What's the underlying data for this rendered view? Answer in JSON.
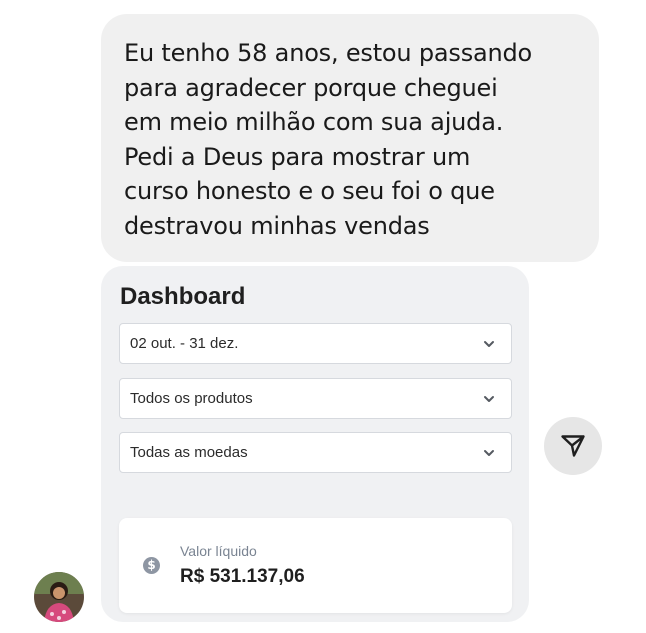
{
  "message": {
    "lines": [
      "Eu tenho 58 anos, estou passando",
      "para agradecer porque cheguei",
      "em meio milhão com sua ajuda.",
      "Pedi a Deus para mostrar um",
      "curso honesto e o seu foi o que",
      "destravou minhas vendas"
    ]
  },
  "dashboard": {
    "title": "Dashboard",
    "filters": {
      "date_range": "02 out. - 31 dez.",
      "products": "Todos os produtos",
      "currency": "Todas as moedas"
    },
    "stat": {
      "icon": "dollar-icon",
      "symbol": "$",
      "label": "Valor líquido",
      "value": "R$ 531.137,06"
    }
  },
  "colors": {
    "bubble_bg": "#f0f0f0",
    "card_bg": "#f0f1f3",
    "share_bg": "#e6e6e6"
  }
}
